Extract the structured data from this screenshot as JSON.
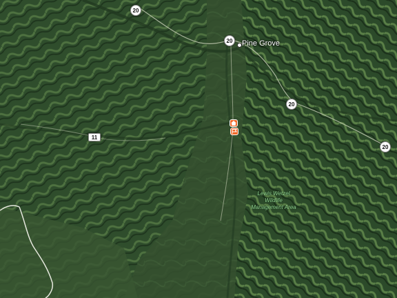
{
  "map": {
    "view": "satellite",
    "colors": {
      "terrain_base": "#2f4d2c",
      "ridge_light": "#577a45",
      "valley_dark": "#1d331c",
      "road": "#d8dcc8",
      "pin": "#f06a2a",
      "area_label": "#8fd08f"
    }
  },
  "shields": [
    {
      "route": "20",
      "icon": "state-route-shield"
    },
    {
      "route": "20",
      "icon": "state-route-shield"
    },
    {
      "route": "20",
      "icon": "state-route-shield"
    },
    {
      "route": "20",
      "icon": "state-route-shield"
    },
    {
      "route": "11",
      "icon": "county-route-shield"
    }
  ],
  "places": {
    "town": "Pine Grove",
    "area_line1": "Lewis Wetzel",
    "area_line2": "Wildlife",
    "area_line3": "Management Area"
  },
  "pins": [
    {
      "icon": "home-icon"
    },
    {
      "icon": "location-flag-icon"
    }
  ]
}
